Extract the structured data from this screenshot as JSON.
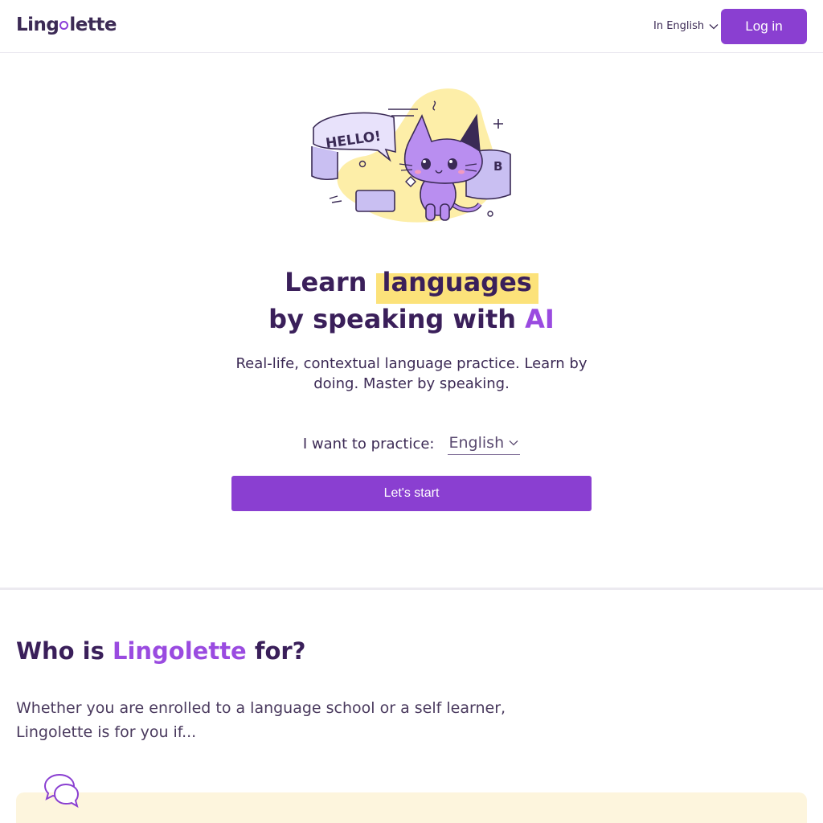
{
  "header": {
    "logo_text": "Lingolette",
    "language_label": "In English",
    "login_label": "Log in"
  },
  "hero": {
    "illustration": {
      "speech_text": "HELLO!",
      "badge_text": "B"
    },
    "headline_part1": "Learn",
    "headline_highlight": "languages",
    "headline_part2": "by speaking with",
    "headline_accent": "AI",
    "subtitle": "Real-life, contextual language practice. Learn by doing. Master by speaking.",
    "practice_label": "I want to practice:",
    "practice_value": "English",
    "start_label": "Let's start"
  },
  "who": {
    "title_prefix": "Who is",
    "title_brand": "Lingolette",
    "title_suffix": "for?",
    "description": "Whether you are enrolled to a language school or a self learner, Lingolette is for you if...",
    "card_icon": "chat-bubbles-icon"
  },
  "colors": {
    "primary": "#8a3fd1",
    "accent": "#9a4be0",
    "highlight": "#fce27a",
    "dark": "#3a1f5a"
  }
}
